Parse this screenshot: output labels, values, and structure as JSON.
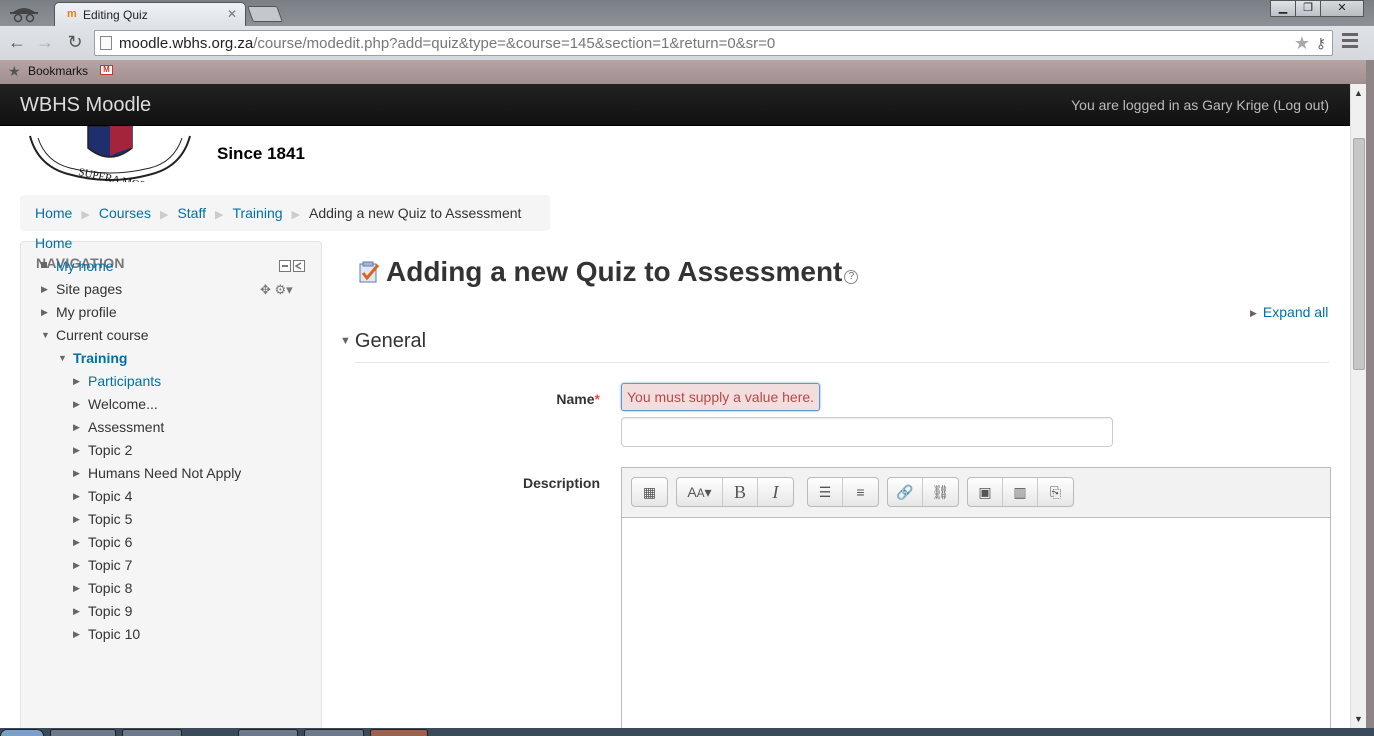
{
  "browser": {
    "tab_title": "Editing Quiz",
    "tab_favicon": "m",
    "url_host": "moodle.wbhs.org.za",
    "url_path": "/course/modedit.php?add=quiz&type=&course=145&section=1&return=0&sr=0",
    "bookmarks_label": "Bookmarks",
    "gmail_icon": "M"
  },
  "site": {
    "brand": "WBHS Moodle",
    "login_info": "You are logged in as Gary Krige (Log out)",
    "motto": "SUPERA MORAS",
    "since": "Since 1841"
  },
  "breadcrumb": {
    "items": [
      "Home",
      "Courses",
      "Staff",
      "Training"
    ],
    "current": "Adding a new Quiz to Assessment"
  },
  "navigation": {
    "title": "NAVIGATION",
    "items": [
      {
        "label": "Home"
      },
      {
        "label": "My home"
      },
      {
        "label": "Site pages"
      },
      {
        "label": "My profile"
      },
      {
        "label": "Current course"
      },
      {
        "label": "Training"
      },
      {
        "label": "Participants"
      },
      {
        "label": "Welcome..."
      },
      {
        "label": "Assessment"
      },
      {
        "label": "Topic 2"
      },
      {
        "label": "Humans Need Not Apply"
      },
      {
        "label": "Topic 4"
      },
      {
        "label": "Topic 5"
      },
      {
        "label": "Topic 6"
      },
      {
        "label": "Topic 7"
      },
      {
        "label": "Topic 8"
      },
      {
        "label": "Topic 9"
      },
      {
        "label": "Topic 10"
      }
    ]
  },
  "main": {
    "heading": "Adding a new Quiz to Assessment",
    "expand_all": "Expand all",
    "section_general": "General",
    "name_label": "Name",
    "required_mark": "*",
    "name_error": "You must supply a value here.",
    "name_value": "",
    "description_label": "Description"
  },
  "colors": {
    "link": "#0070a8",
    "navbar": "#1a1a1a",
    "error_bg": "#f2dede",
    "error_text": "#b94a48"
  }
}
